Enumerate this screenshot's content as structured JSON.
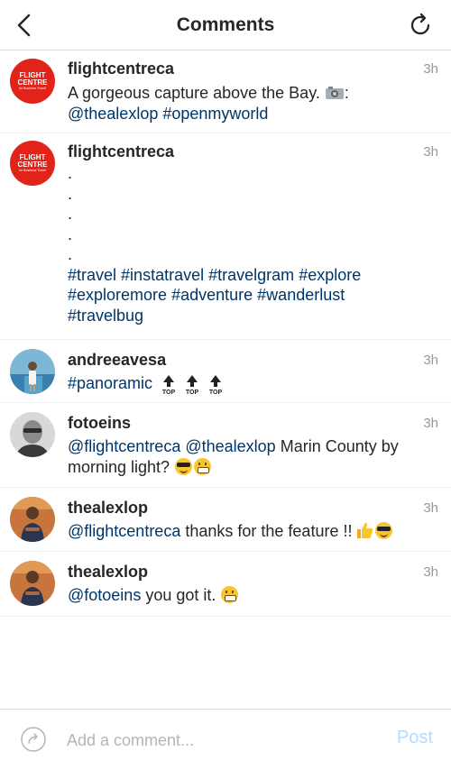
{
  "header": {
    "title": "Comments",
    "back_icon": "chevron-left-icon",
    "refresh_icon": "refresh-icon"
  },
  "comments": [
    {
      "username": "flightcentreca",
      "time": "3h",
      "avatar": {
        "type": "logo",
        "line1": "FLIGHT",
        "line2": "CENTRE",
        "line3": "for Business Travel"
      },
      "text_main": "A gorgeous capture above the Bay.",
      "text_after": ":",
      "mentions": [
        "@thealexlop",
        "#openmyworld"
      ]
    },
    {
      "username": "flightcentreca",
      "time": "3h",
      "avatar": {
        "type": "logo",
        "line1": "FLIGHT",
        "line2": "CENTRE",
        "line3": "for Business Travel"
      },
      "dots": [
        ".",
        ".",
        ".",
        ".",
        "."
      ],
      "hashtags": [
        "#travel",
        "#instatravel",
        "#travelgram",
        "#explore",
        "#exploremore",
        "#adventure",
        "#wanderlust",
        "#travelbug"
      ]
    },
    {
      "username": "andreeavesa",
      "time": "3h",
      "hashtag": "#panoramic",
      "top_label": "TOP"
    },
    {
      "username": "fotoeins",
      "time": "3h",
      "mentions": [
        "@flightcentreca",
        "@thealexlop"
      ],
      "text": "Marin County by morning light?"
    },
    {
      "username": "thealexlop",
      "time": "3h",
      "mention": "@flightcentreca",
      "text": "thanks for the feature !!"
    },
    {
      "username": "thealexlop",
      "time": "3h",
      "mention": "@fotoeins",
      "text": "you got it."
    }
  ],
  "footer": {
    "placeholder": "Add a comment...",
    "post_label": "Post",
    "reply_icon": "reply-icon"
  },
  "colors": {
    "link": "#003569",
    "post_disabled": "#b3dbff",
    "brand_red": "#e2231a"
  }
}
